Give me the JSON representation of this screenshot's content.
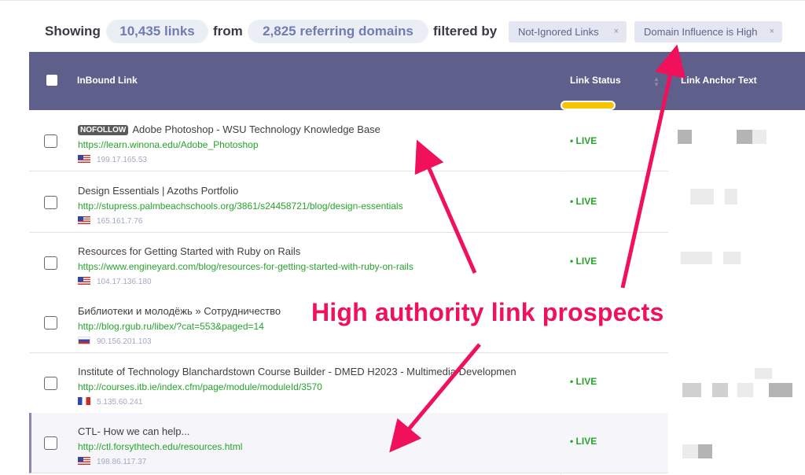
{
  "summary": {
    "showing_label": "Showing",
    "links_count": "10,435 links",
    "from_label": "from",
    "domains_count": "2,825 referring domains",
    "filtered_label": "filtered by",
    "filters": [
      {
        "label": "Not-Ignored Links",
        "remove": "×"
      },
      {
        "label": "Domain Influence is High",
        "remove": "×"
      }
    ]
  },
  "table": {
    "columns": {
      "inbound": "InBound Link",
      "status": "Link Status",
      "anchor": "Link Anchor Text"
    },
    "active_sort_color": "#f7c400",
    "rows": [
      {
        "badge": "NOFOLLOW",
        "title": "Adobe Photoshop - WSU Technology Knowledge Base",
        "url": "https://learn.winona.edu/Adobe_Photoshop",
        "ip": "199.17.165.53",
        "flag": "us",
        "status": "• LIVE"
      },
      {
        "badge": "",
        "title": "Design Essentials | Azoths Portfolio",
        "url": "http://stupress.palmbeachschools.org/3861/s24458721/blog/design-essentials",
        "ip": "165.161.7.76",
        "flag": "us",
        "status": "• LIVE"
      },
      {
        "badge": "",
        "title": "Resources for Getting Started with Ruby on Rails",
        "url": "https://www.engineyard.com/blog/resources-for-getting-started-with-ruby-on-rails",
        "ip": "104.17.136.180",
        "flag": "us",
        "status": "• LIVE"
      },
      {
        "badge": "",
        "title": "Библиотеки и молодёжь » Сотрудничество",
        "url": "http://blog.rgub.ru/libex/?cat=553&paged=14",
        "ip": "90.156.201.103",
        "flag": "ru",
        "status": ""
      },
      {
        "badge": "",
        "title": "Institute of Technology Blanchardstown Course Builder - DMED H2023 - Multimedia Developmen",
        "url": "http://courses.itb.ie/index.cfm/page/module/moduleId/3570",
        "ip": "5.135.60.241",
        "flag": "fr",
        "status": "• LIVE"
      },
      {
        "badge": "",
        "title": "CTL- How we can help...",
        "url": "http://ctl.forsythtech.edu/resources.html",
        "ip": "198.86.117.37",
        "flag": "us",
        "status": "• LIVE"
      }
    ]
  },
  "annotation": {
    "text": "High authority link prospects",
    "color": "#f0115a"
  },
  "colors": {
    "header_bg": "#5f5f8c",
    "url_green": "#27a42d",
    "pill_bg": "#eceef6"
  }
}
